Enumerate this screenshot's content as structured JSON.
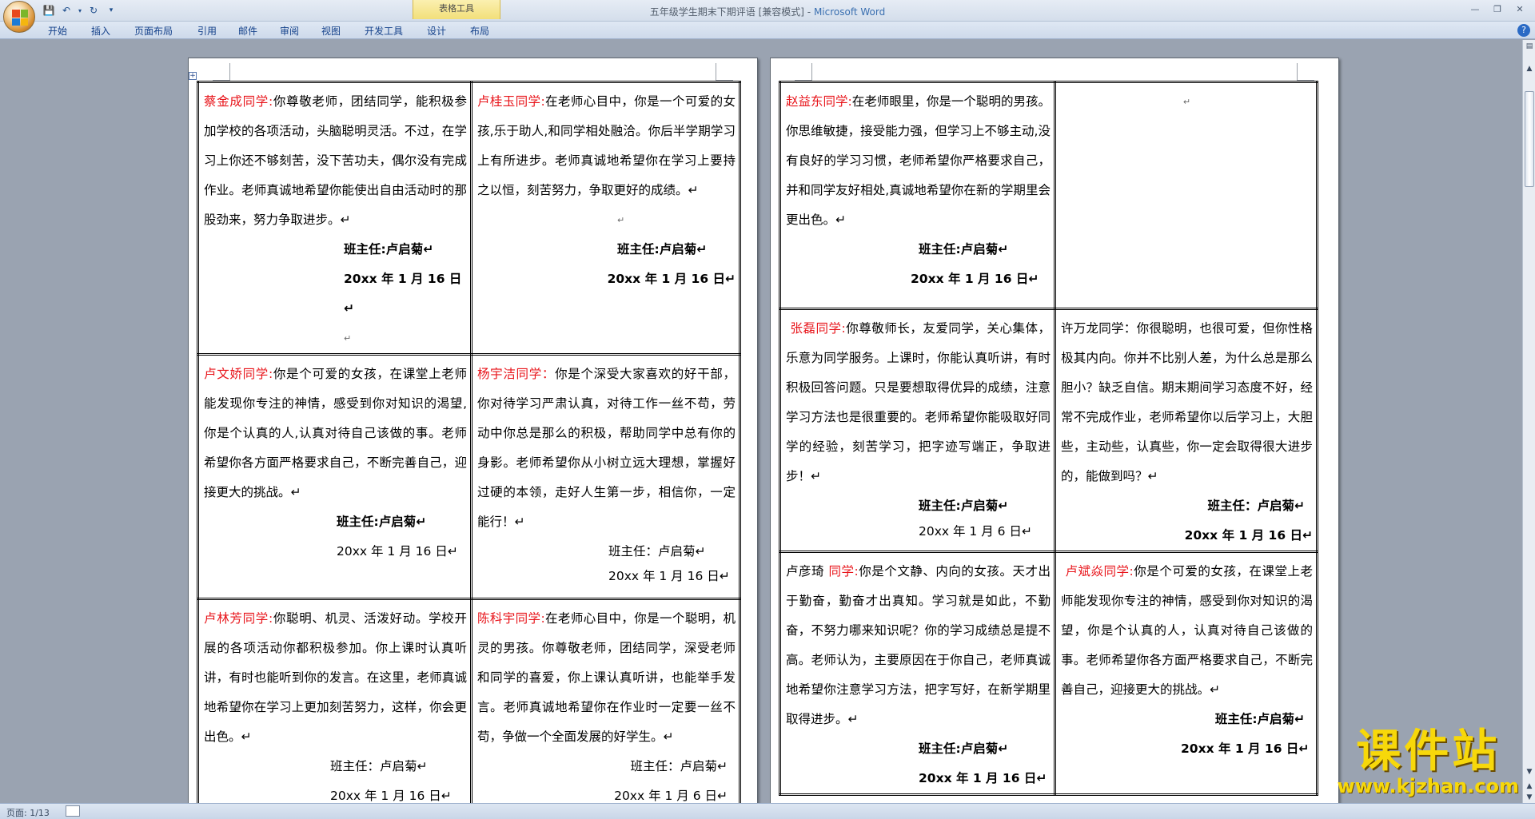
{
  "window": {
    "title_doc": "五年级学生期末下期评语 [兼容模式]",
    "title_sep": " - ",
    "title_app": "Microsoft Word",
    "contextual_group": "表格工具"
  },
  "ribbon": {
    "tabs": [
      "开始",
      "插入",
      "页面布局",
      "引用",
      "邮件",
      "审阅",
      "视图",
      "开发工具",
      "设计",
      "布局"
    ]
  },
  "status": {
    "page": "页面: 1/13"
  },
  "watermark": {
    "cn": "课件站",
    "url": "www.kjzhan.com"
  },
  "pages": {
    "left": {
      "c1": {
        "name": "蔡金成同学:",
        "text": "你尊敬老师，团结同学，能积极参加学校的各项活动，头脑聪明灵活。不过，在学习上你还不够刻苦，没下苦功夫，偶尔没有完成作业。老师真诚地希望你能使出自由活动时的那股劲来，努力争取进步。↵",
        "sig": "班主任:卢启菊↵",
        "date": "20xx 年 1 月 16 日↵",
        "after": "↵"
      },
      "c2": {
        "name": "卢桂玉同学:",
        "text": "在老师心目中，你是一个可爱的女孩,乐于助人,和同学相处融洽。你后半学期学习上有所进步。老师真诚地希望你在学习上要持之以恒，刻苦努力，争取更好的成绩。↵",
        "blank": "↵",
        "sig": "班主任:卢启菊↵",
        "date": "20xx 年 1 月 16 日↵"
      },
      "c3": {
        "name": "卢文娇同学:",
        "text": "你是个可爱的女孩，在课堂上老师能发现你专注的神情，感受到你对知识的渴望,你是个认真的人,认真对待自己该做的事。老师希望你各方面严格要求自己，不断完善自己，迎接更大的挑战。↵",
        "sig": "班主任:卢启菊↵",
        "date": "20xx 年 1 月 16 日↵"
      },
      "c4": {
        "name": "杨宇洁同学：",
        "text": "你是个深受大家喜欢的好干部，你对待学习严肃认真，对待工作一丝不苟，劳动中你总是那么的积极，帮助同学中总有你的身影。老师希望你从小树立远大理想，掌握好过硬的本领，走好人生第一步，相信你，一定能行！↵",
        "sig": "班主任：卢启菊↵",
        "date": "20xx 年 1 月 16 日↵"
      },
      "c5": {
        "name": "卢林芳同学:",
        "text": "你聪明、机灵、活泼好动。学校开展的各项活动你都积极参加。你上课时认真听讲，有时也能听到你的发言。在这里，老师真诚地希望你在学习上更加刻苦努力，这样，你会更出色。↵",
        "sig": "班主任：卢启菊↵",
        "date": "20xx 年 1 月 16 日↵"
      },
      "c6": {
        "name": "陈科宇同学:",
        "text": "在老师心目中，你是一个聪明，机灵的男孩。你尊敬老师，团结同学，深受老师和同学的喜爱，你上课认真听讲，也能举手发言。老师真诚地希望你在作业时一定要一丝不苟，争做一个全面发展的好学生。↵",
        "sig": "班主任：卢启菊↵",
        "date": "20xx 年 1 月 6 日↵"
      }
    },
    "right": {
      "c1": {
        "name": "赵益东同学:",
        "text": "在老师眼里，你是一个聪明的男孩。你思维敏捷，接受能力强，但学习上不够主动,没有良好的学习习惯，老师希望你严格要求自己，并和同学友好相处,真诚地希望你在新的学期里会更出色。↵",
        "sig": "班主任:卢启菊↵",
        "date": "20xx 年 1 月 16 日↵"
      },
      "c2": {
        "blank": "↵"
      },
      "c3": {
        "name": "张磊同学:",
        "text": "你尊敬师长，友爱同学，关心集体，乐意为同学服务。上课时，你能认真听讲，有时积极回答问题。只是要想取得优异的成绩，注意学习方法也是很重要的。老师希望你能吸取好同学的经验，刻苦学习，把字迹写端正，争取进步！↵",
        "sig": "班主任:卢启菊↵",
        "date": "20xx 年 1 月 6 日↵"
      },
      "c4": {
        "text": "许万龙同学：你很聪明，也很可爱，但你性格极其内向。你并不比别人差，为什么总是那么胆小？缺乏自信。期末期间学习态度不好，经常不完成作业，老师希望你以后学习上，大胆些，主动些，认真些，你一定会取得很大进步的，能做到吗？↵",
        "sig": "班主任：卢启菊↵",
        "date": "20xx 年 1 月 16 日↵"
      },
      "c5": {
        "pre": "卢彦琦 ",
        "name": "同学:",
        "text": "你是个文静、内向的女孩。天才出于勤奋，勤奋才出真知。学习就是如此，不勤奋，不努力哪来知识呢？你的学习成绩总是提不高。老师认为，主要原因在于你自己，老师真诚地希望你注意学习方法，把字写好，在新学期里取得进步。↵",
        "sig": "班主任:卢启菊↵",
        "date": "20xx 年 1 月 16 日↵"
      },
      "c6": {
        "name": "卢斌焱同学:",
        "text": "你是个可爱的女孩，在课堂上老师能发现你专注的神情，感受到你对知识的渴望，你是个认真的人，认真对待自己该做的事。老师希望你各方面严格要求自己，不断完善自己，迎接更大的挑战。↵",
        "sig": "班主任:卢启菊↵",
        "date": "20xx 年 1 月 16 日↵"
      }
    }
  }
}
